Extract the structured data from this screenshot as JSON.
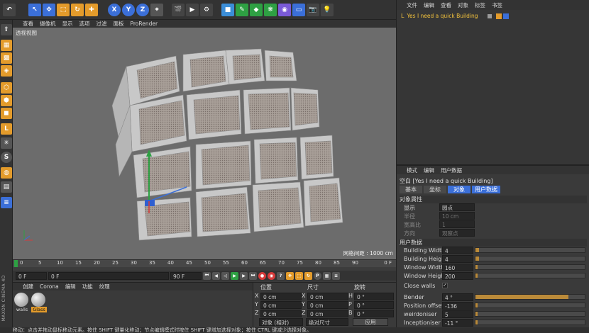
{
  "toolbar": {
    "axis_buttons": [
      "X",
      "Y",
      "Z"
    ],
    "colors": {
      "accent": "#3b6fd8",
      "orange": "#e39b2b",
      "green": "#2ea043"
    }
  },
  "viewport": {
    "menu": [
      "查看",
      "摄像机",
      "显示",
      "选项",
      "过滤",
      "面板",
      "ProRender"
    ],
    "label": "透视视图",
    "grid_spacing": "网格间距 : 1000 cm"
  },
  "timeline": {
    "ticks": [
      "0",
      "5",
      "10",
      "15",
      "20",
      "25",
      "30",
      "35",
      "40",
      "45",
      "50",
      "55",
      "60",
      "65",
      "70",
      "75",
      "80",
      "85",
      "90"
    ],
    "end_label": "0 F",
    "start": "0 F",
    "current": "0 F",
    "end1": "90 F",
    "end2": "90 F"
  },
  "material_manager": {
    "menu": [
      "创建",
      "Corona",
      "编辑",
      "功能",
      "纹理"
    ],
    "materials": [
      {
        "name": "walls"
      },
      {
        "name": "Glass"
      }
    ]
  },
  "coordinates": {
    "headers": [
      "位置",
      "尺寸",
      "旋转"
    ],
    "rows": [
      {
        "axis": "X",
        "pos": "0 cm",
        "size_axis": "X",
        "size": "0 cm",
        "rot_axis": "H",
        "rot": "0 °"
      },
      {
        "axis": "Y",
        "pos": "0 cm",
        "size_axis": "Y",
        "size": "0 cm",
        "rot_axis": "P",
        "rot": "0 °"
      },
      {
        "axis": "Z",
        "pos": "0 cm",
        "size_axis": "Z",
        "size": "0 cm",
        "rot_axis": "B",
        "rot": "0 °"
      }
    ],
    "mode": "对象 (相对)",
    "size_mode": "绝对尺寸",
    "apply": "应用"
  },
  "object_manager": {
    "menu": [
      "文件",
      "编辑",
      "查看",
      "对象",
      "标签",
      "书签"
    ],
    "object_name": "Yes I need a quick Building"
  },
  "attribute_manager": {
    "menu": [
      "模式",
      "编辑",
      "用户数据"
    ],
    "title": "空白 [Yes I need a quick Building]",
    "tabs": [
      "基本",
      "坐标",
      "对象",
      "用户数据"
    ],
    "section_object": "对象属性",
    "display_label": "显示",
    "display_value": "圆点",
    "radius_label": "半径",
    "radius_value": "10 cm",
    "aspect_label": "宽高比",
    "aspect_value": "1",
    "orient_label": "方向",
    "orient_value": "观察点",
    "section_user": "用户数据",
    "params": [
      {
        "label": "Building Width",
        "value": "4",
        "fill": 0.03
      },
      {
        "label": "Building Height",
        "value": "4",
        "fill": 0.03
      },
      {
        "label": "Window Width",
        "value": "160",
        "fill": 0.0
      },
      {
        "label": "Window Height",
        "value": "200",
        "fill": 0.0
      },
      {
        "label": "Bender",
        "value": "4 °",
        "fill": 0.85
      },
      {
        "label": "Position offset",
        "value": "-136",
        "fill": 0.02
      },
      {
        "label": "weirdoniser",
        "value": "5",
        "fill": 0.02
      },
      {
        "label": "Inceptioniser",
        "value": "-11 °",
        "fill": 0.02
      }
    ],
    "close_walls": "Close walls"
  },
  "statusbar": {
    "text": "移动：点击并拖动鼠标移动元素。按住 SHIFT 键量化移动；节点编辑模式时按住 SHIFT 键增加选择对象；按住 CTRL 键减少选择对象。"
  },
  "brand": "MAXON CINEMA 4D"
}
